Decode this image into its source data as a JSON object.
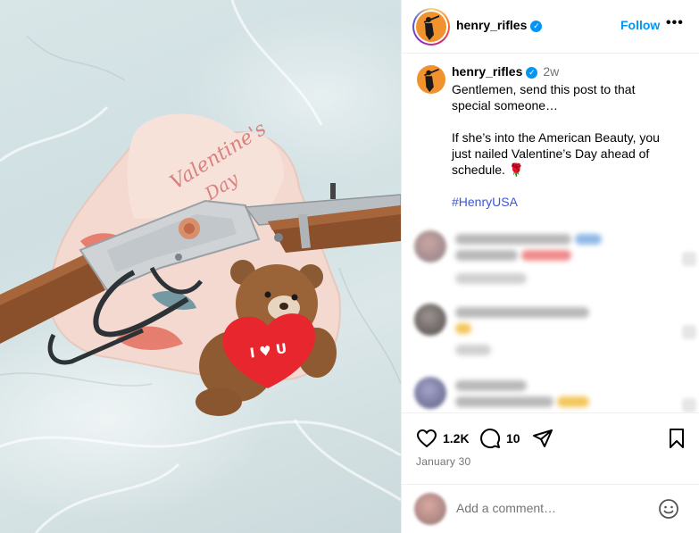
{
  "post": {
    "username": "henry_rifles",
    "follow_label": "Follow",
    "more_label": "•••",
    "verified_mark": "✓",
    "time_ago": "2w",
    "caption_lines": "Gentlemen, send this post to that special someone…\n\nIf she’s into the American Beauty, you just nailed Valentine’s Day ahead of schedule. 🌹\n\n",
    "hashtag": "#HenryUSA",
    "likes": "1.2K",
    "comments_count": "10",
    "date": "January 30"
  },
  "image": {
    "box_text_line1": "Valentine's",
    "box_text_line2": "Day",
    "bear_text": "I ♥ U"
  },
  "add_comment": {
    "placeholder": "Add a comment…"
  },
  "icons": {
    "like": "heart-icon",
    "comment": "comment-icon",
    "share": "share-icon",
    "save": "bookmark-icon",
    "emoji": "emoji-icon",
    "more": "more-icon",
    "verified": "verified-badge-icon"
  },
  "colors": {
    "accent": "#0095f6",
    "hashtag": "#3b55d9",
    "muted": "#737373"
  }
}
